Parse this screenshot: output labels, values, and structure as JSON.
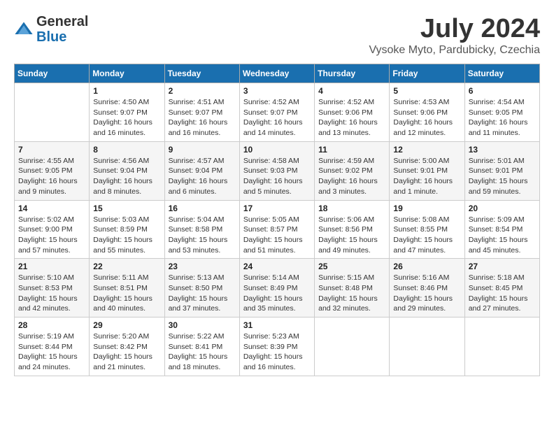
{
  "logo": {
    "general": "General",
    "blue": "Blue"
  },
  "title": {
    "month": "July 2024",
    "location": "Vysoke Myto, Pardubicky, Czechia"
  },
  "headers": [
    "Sunday",
    "Monday",
    "Tuesday",
    "Wednesday",
    "Thursday",
    "Friday",
    "Saturday"
  ],
  "weeks": [
    [
      {
        "day": "",
        "info": ""
      },
      {
        "day": "1",
        "info": "Sunrise: 4:50 AM\nSunset: 9:07 PM\nDaylight: 16 hours\nand 16 minutes."
      },
      {
        "day": "2",
        "info": "Sunrise: 4:51 AM\nSunset: 9:07 PM\nDaylight: 16 hours\nand 16 minutes."
      },
      {
        "day": "3",
        "info": "Sunrise: 4:52 AM\nSunset: 9:07 PM\nDaylight: 16 hours\nand 14 minutes."
      },
      {
        "day": "4",
        "info": "Sunrise: 4:52 AM\nSunset: 9:06 PM\nDaylight: 16 hours\nand 13 minutes."
      },
      {
        "day": "5",
        "info": "Sunrise: 4:53 AM\nSunset: 9:06 PM\nDaylight: 16 hours\nand 12 minutes."
      },
      {
        "day": "6",
        "info": "Sunrise: 4:54 AM\nSunset: 9:05 PM\nDaylight: 16 hours\nand 11 minutes."
      }
    ],
    [
      {
        "day": "7",
        "info": "Sunrise: 4:55 AM\nSunset: 9:05 PM\nDaylight: 16 hours\nand 9 minutes."
      },
      {
        "day": "8",
        "info": "Sunrise: 4:56 AM\nSunset: 9:04 PM\nDaylight: 16 hours\nand 8 minutes."
      },
      {
        "day": "9",
        "info": "Sunrise: 4:57 AM\nSunset: 9:04 PM\nDaylight: 16 hours\nand 6 minutes."
      },
      {
        "day": "10",
        "info": "Sunrise: 4:58 AM\nSunset: 9:03 PM\nDaylight: 16 hours\nand 5 minutes."
      },
      {
        "day": "11",
        "info": "Sunrise: 4:59 AM\nSunset: 9:02 PM\nDaylight: 16 hours\nand 3 minutes."
      },
      {
        "day": "12",
        "info": "Sunrise: 5:00 AM\nSunset: 9:01 PM\nDaylight: 16 hours\nand 1 minute."
      },
      {
        "day": "13",
        "info": "Sunrise: 5:01 AM\nSunset: 9:01 PM\nDaylight: 15 hours\nand 59 minutes."
      }
    ],
    [
      {
        "day": "14",
        "info": "Sunrise: 5:02 AM\nSunset: 9:00 PM\nDaylight: 15 hours\nand 57 minutes."
      },
      {
        "day": "15",
        "info": "Sunrise: 5:03 AM\nSunset: 8:59 PM\nDaylight: 15 hours\nand 55 minutes."
      },
      {
        "day": "16",
        "info": "Sunrise: 5:04 AM\nSunset: 8:58 PM\nDaylight: 15 hours\nand 53 minutes."
      },
      {
        "day": "17",
        "info": "Sunrise: 5:05 AM\nSunset: 8:57 PM\nDaylight: 15 hours\nand 51 minutes."
      },
      {
        "day": "18",
        "info": "Sunrise: 5:06 AM\nSunset: 8:56 PM\nDaylight: 15 hours\nand 49 minutes."
      },
      {
        "day": "19",
        "info": "Sunrise: 5:08 AM\nSunset: 8:55 PM\nDaylight: 15 hours\nand 47 minutes."
      },
      {
        "day": "20",
        "info": "Sunrise: 5:09 AM\nSunset: 8:54 PM\nDaylight: 15 hours\nand 45 minutes."
      }
    ],
    [
      {
        "day": "21",
        "info": "Sunrise: 5:10 AM\nSunset: 8:53 PM\nDaylight: 15 hours\nand 42 minutes."
      },
      {
        "day": "22",
        "info": "Sunrise: 5:11 AM\nSunset: 8:51 PM\nDaylight: 15 hours\nand 40 minutes."
      },
      {
        "day": "23",
        "info": "Sunrise: 5:13 AM\nSunset: 8:50 PM\nDaylight: 15 hours\nand 37 minutes."
      },
      {
        "day": "24",
        "info": "Sunrise: 5:14 AM\nSunset: 8:49 PM\nDaylight: 15 hours\nand 35 minutes."
      },
      {
        "day": "25",
        "info": "Sunrise: 5:15 AM\nSunset: 8:48 PM\nDaylight: 15 hours\nand 32 minutes."
      },
      {
        "day": "26",
        "info": "Sunrise: 5:16 AM\nSunset: 8:46 PM\nDaylight: 15 hours\nand 29 minutes."
      },
      {
        "day": "27",
        "info": "Sunrise: 5:18 AM\nSunset: 8:45 PM\nDaylight: 15 hours\nand 27 minutes."
      }
    ],
    [
      {
        "day": "28",
        "info": "Sunrise: 5:19 AM\nSunset: 8:44 PM\nDaylight: 15 hours\nand 24 minutes."
      },
      {
        "day": "29",
        "info": "Sunrise: 5:20 AM\nSunset: 8:42 PM\nDaylight: 15 hours\nand 21 minutes."
      },
      {
        "day": "30",
        "info": "Sunrise: 5:22 AM\nSunset: 8:41 PM\nDaylight: 15 hours\nand 18 minutes."
      },
      {
        "day": "31",
        "info": "Sunrise: 5:23 AM\nSunset: 8:39 PM\nDaylight: 15 hours\nand 16 minutes."
      },
      {
        "day": "",
        "info": ""
      },
      {
        "day": "",
        "info": ""
      },
      {
        "day": "",
        "info": ""
      }
    ]
  ]
}
